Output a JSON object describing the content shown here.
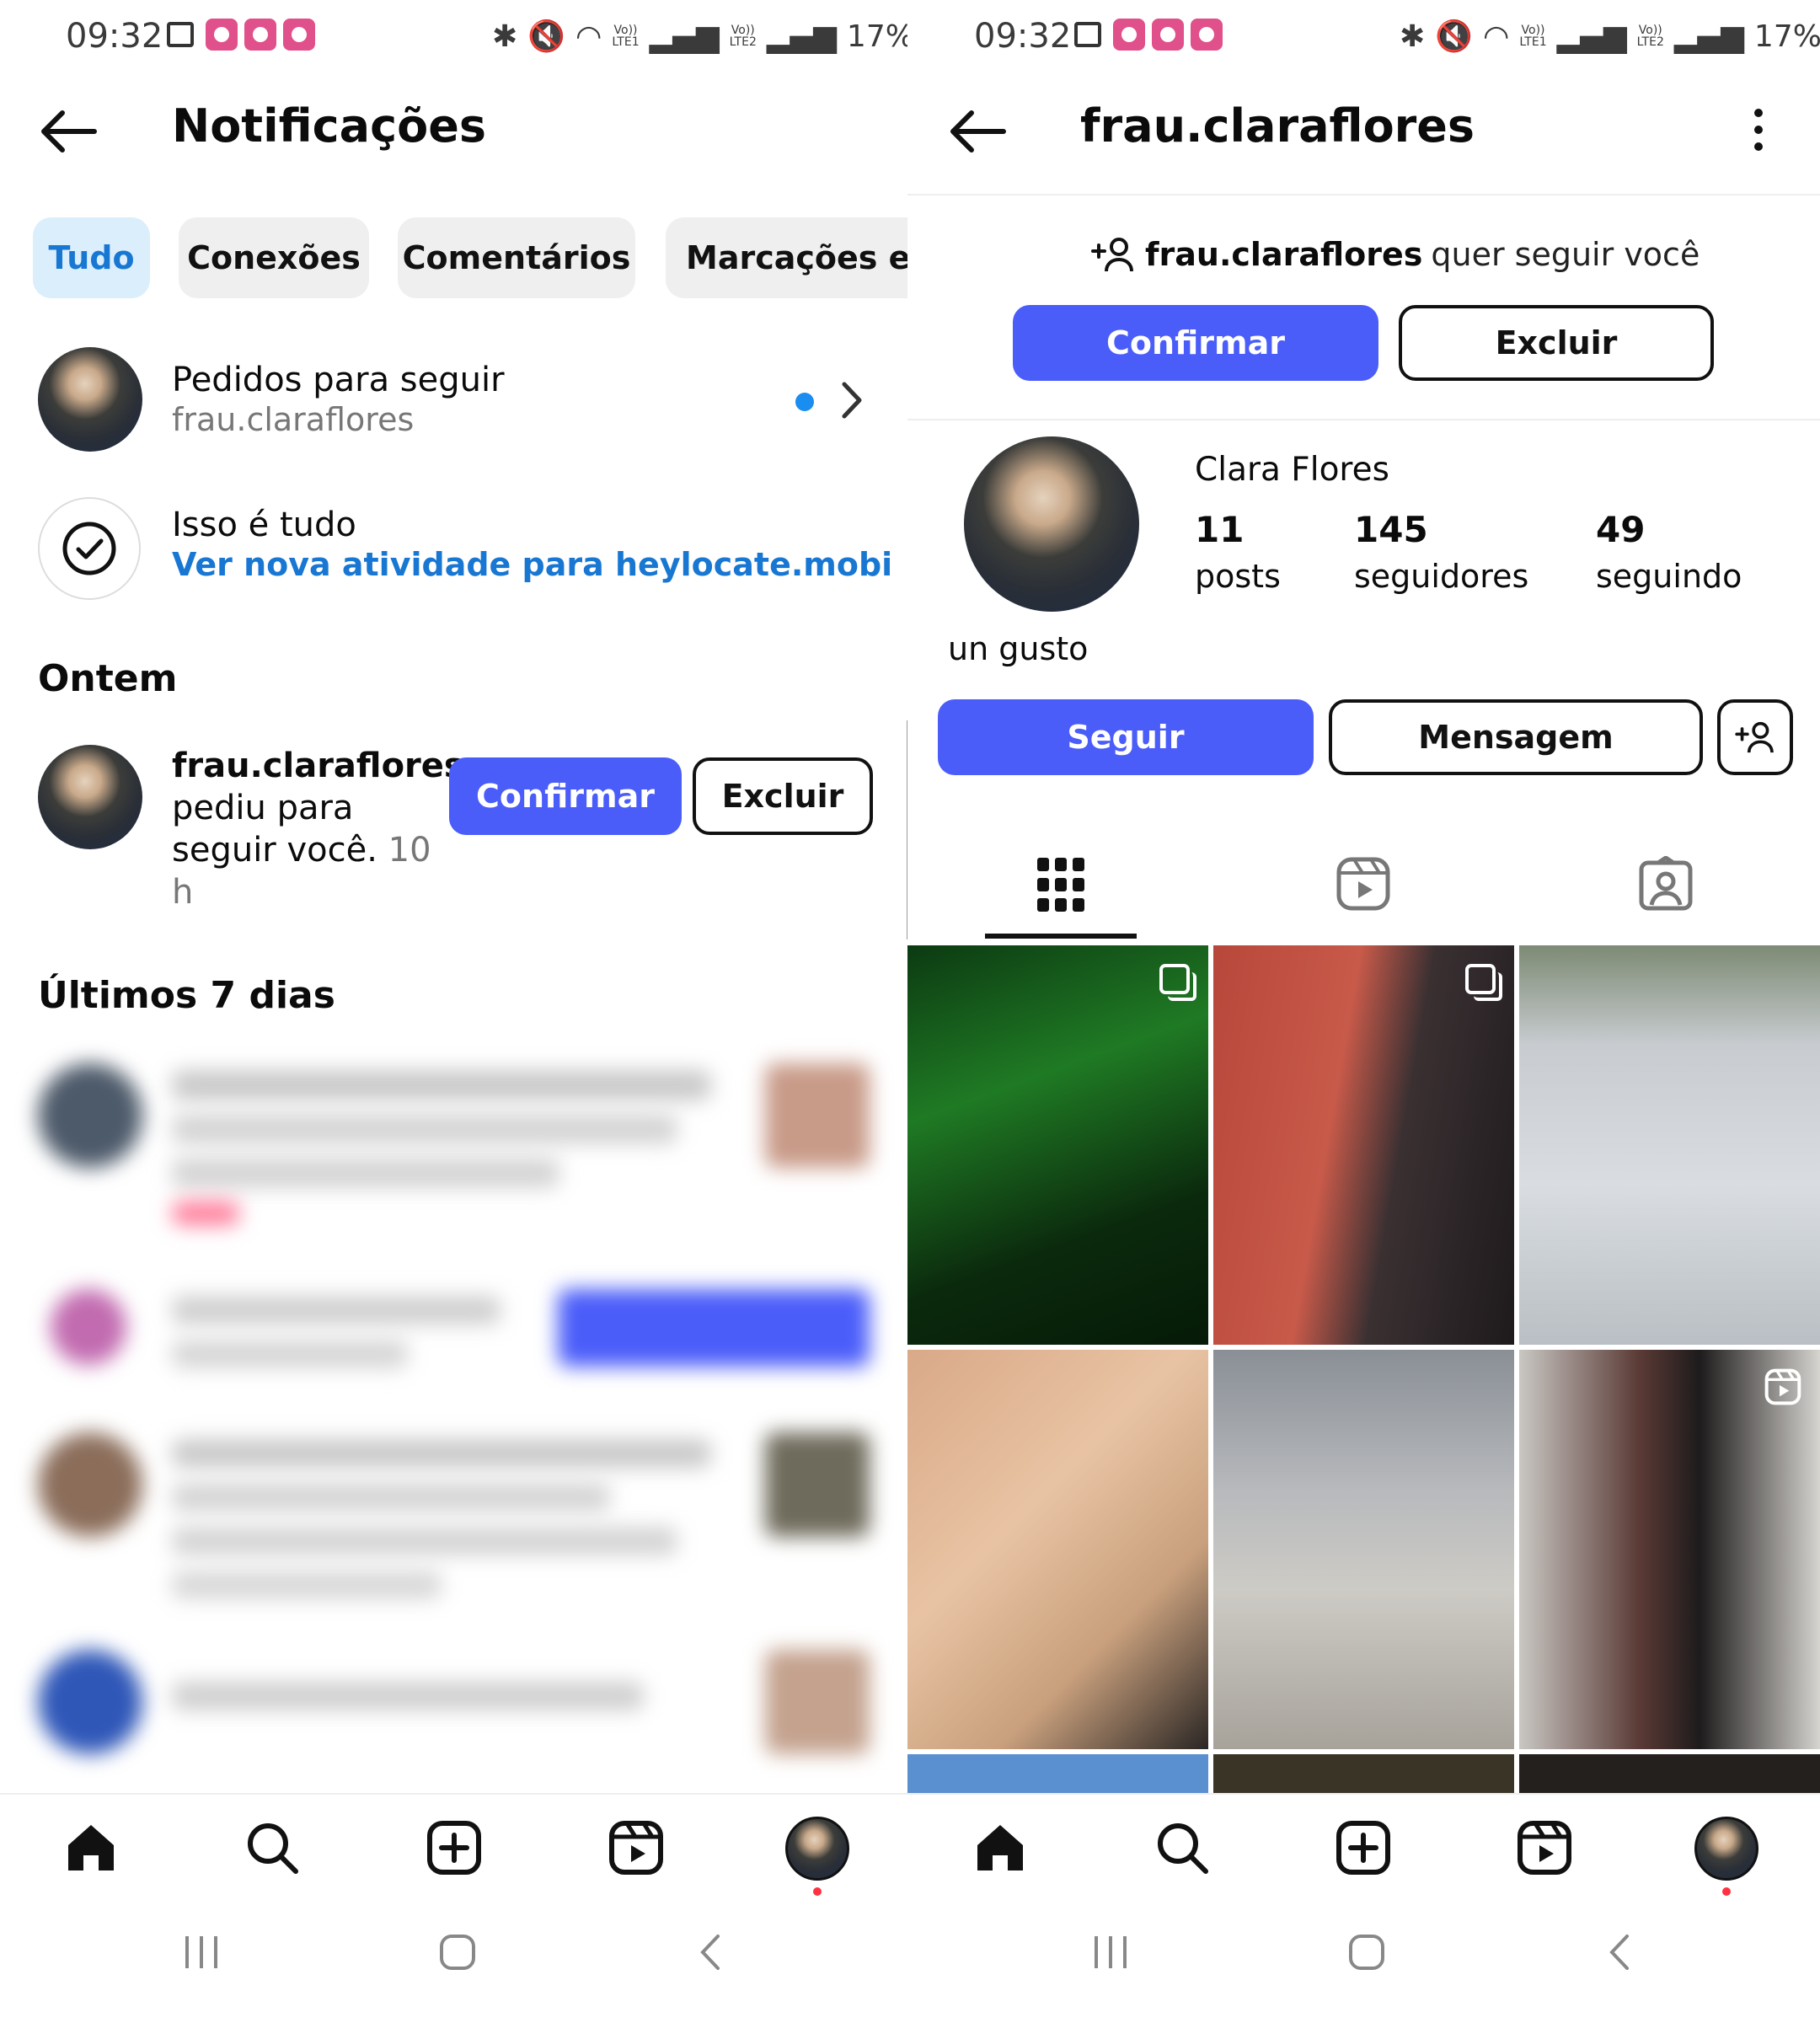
{
  "status_bar": {
    "time": "09:32",
    "battery": "17%",
    "lte1": "LTE1",
    "lte2": "LTE2",
    "vo": "Vo))"
  },
  "left": {
    "title": "Notificações",
    "tabs": [
      "Tudo",
      "Conexões",
      "Comentários",
      "Marcações e m"
    ],
    "follow_requests": {
      "title": "Pedidos para seguir",
      "user": "frau.claraflores"
    },
    "all_caught_up": {
      "title": "Isso é tudo",
      "link": "Ver nova atividade para heylocate.mobi"
    },
    "section_yesterday": "Ontem",
    "request_item": {
      "username": "frau.claraflores",
      "text_line1": "pediu para",
      "text_line2": "seguir você.",
      "time": "10",
      "time_unit": "h",
      "confirm": "Confirmar",
      "delete": "Excluir"
    },
    "section_week": "Últimos 7 dias"
  },
  "right": {
    "title": "frau.claraflores",
    "request_banner": {
      "username": "frau.claraflores",
      "text": "quer seguir você",
      "confirm": "Confirmar",
      "delete": "Excluir"
    },
    "profile": {
      "name": "Clara Flores",
      "bio": "un gusto",
      "stats": [
        {
          "value": "11",
          "label": "posts"
        },
        {
          "value": "145",
          "label": "seguidores"
        },
        {
          "value": "49",
          "label": "seguindo"
        }
      ],
      "follow": "Seguir",
      "message": "Mensagem"
    }
  },
  "colors": {
    "accent": "#4a5df9",
    "link": "#1877d2",
    "active_chip": "#dbeefb",
    "notification_dot": "#1a8df0",
    "badge_dot": "#ff3040"
  },
  "icons": [
    "back-arrow-icon",
    "chevron-right-icon",
    "check-circle-icon",
    "home-icon",
    "search-icon",
    "create-icon",
    "reels-icon",
    "grid-icon",
    "tagged-icon",
    "add-person-icon",
    "more-icon"
  ]
}
